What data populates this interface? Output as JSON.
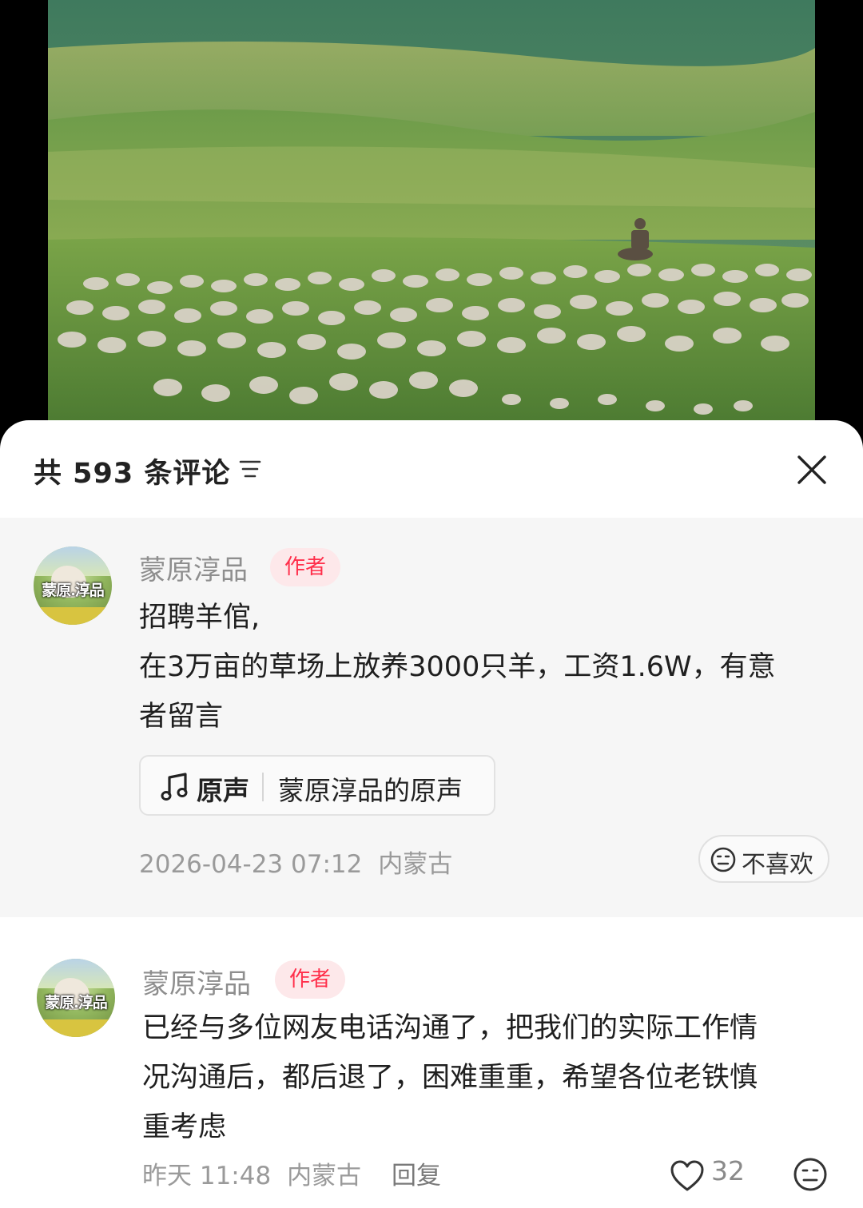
{
  "video": {
    "description_hidden": ""
  },
  "sheet": {
    "count_label": "共 593 条评论",
    "sort_icon": "sort-lines-icon",
    "close_icon": "close-x-icon"
  },
  "comments": [
    {
      "avatar_text": "蒙原.淳品",
      "author": "蒙原淳品",
      "badge": "作者",
      "lines": [
        "招聘羊倌,",
        "在3万亩的草场上放养3000只羊，工资1.6W，有意",
        "者留言"
      ],
      "sound_label": "原声",
      "sound_name": "蒙原淳品的原声",
      "timestamp": "2026-04-23 07:12",
      "location": "内蒙古",
      "dislike_label": "不喜欢"
    },
    {
      "avatar_text": "蒙原.淳品",
      "author": "蒙原淳品",
      "badge": "作者",
      "lines": [
        "已经与多位网友电话沟通了，把我们的实际工作情",
        "况沟通后，都后退了，困难重重，希望各位老铁慎",
        "重考虑"
      ],
      "timestamp": "昨天 11:48",
      "location": "内蒙古",
      "reply_label": "回复",
      "likes": "32"
    }
  ],
  "colors": {
    "badge_text": "#ff2f4b",
    "badge_bg": "#fde8ea",
    "pinned_bg": "#f6f6f6"
  }
}
